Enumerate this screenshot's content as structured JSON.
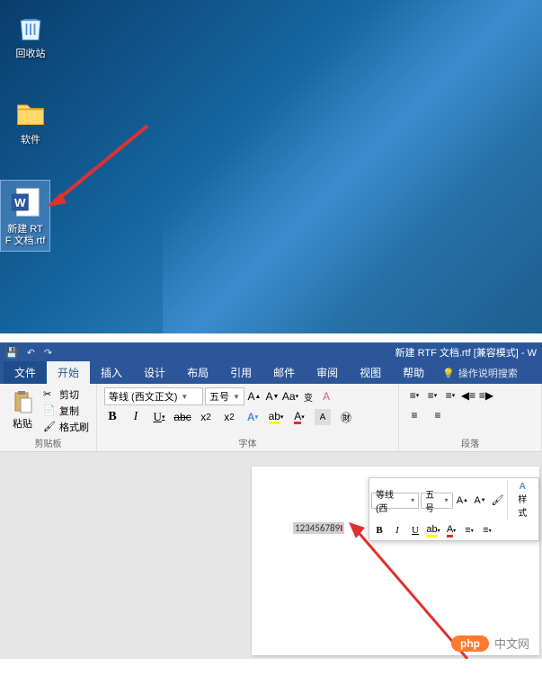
{
  "desktop": {
    "icons": {
      "recycle": "回收站",
      "software": "软件",
      "rtf_doc": "新建 RTF 文档.rtf"
    }
  },
  "word": {
    "title": "新建 RTF 文档.rtf [兼容模式] - W",
    "tabs": {
      "file": "文件",
      "home": "开始",
      "insert": "插入",
      "design": "设计",
      "layout": "布局",
      "references": "引用",
      "mailings": "邮件",
      "review": "审阅",
      "view": "视图",
      "help": "帮助"
    },
    "tell_me": "操作说明搜索",
    "clipboard": {
      "paste": "粘贴",
      "cut": "剪切",
      "copy": "复制",
      "format_painter": "格式刷",
      "group_label": "剪贴板"
    },
    "font": {
      "name": "等线 (西文正文)",
      "size": "五号",
      "group_label": "字体"
    },
    "paragraph": {
      "group_label": "段落"
    },
    "mini_toolbar": {
      "font_name": "等线 (西",
      "font_size": "五号",
      "styles": "样式"
    },
    "document_text": "123456789"
  },
  "watermark": {
    "badge": "php",
    "text": "中文网"
  }
}
